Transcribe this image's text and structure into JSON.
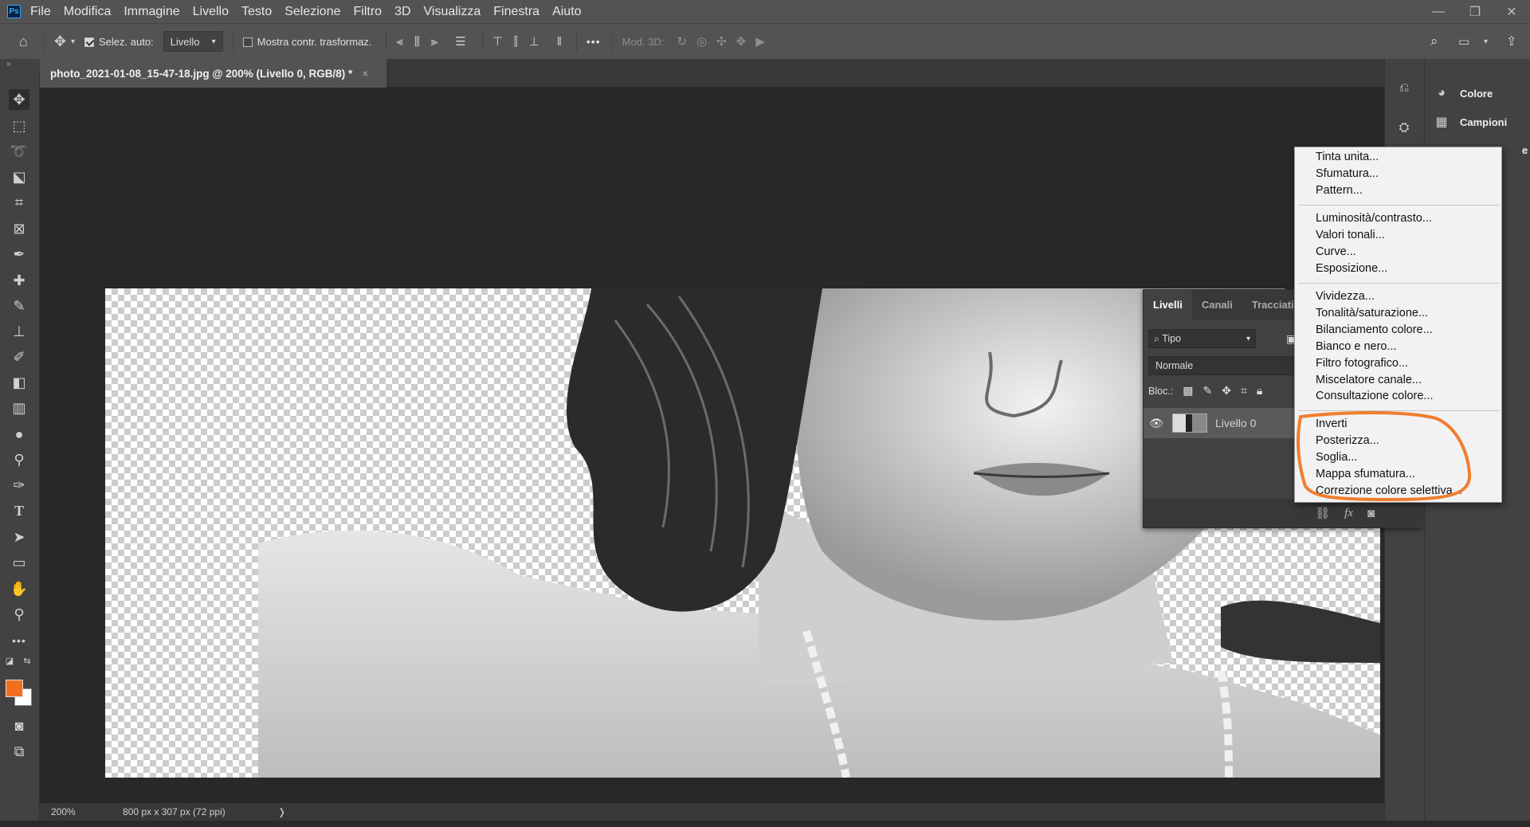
{
  "menubar": {
    "logo": "Ps",
    "items": [
      "File",
      "Modifica",
      "Immagine",
      "Livello",
      "Testo",
      "Selezione",
      "Filtro",
      "3D",
      "Visualizza",
      "Finestra",
      "Aiuto"
    ],
    "window_controls": [
      "—",
      "❐",
      "✕"
    ]
  },
  "options": {
    "auto_select_label": "Selez. auto:",
    "auto_select_checked": true,
    "auto_select_value": "Livello",
    "transform_controls_label": "Mostra contr. trasformaz.",
    "transform_controls_checked": false,
    "mode3d_label": "Mod. 3D:",
    "more": "•••"
  },
  "document": {
    "tab_title": "photo_2021-01-08_15-47-18.jpg @ 200% (Livello 0, RGB/8) *",
    "tab_close": "×"
  },
  "status": {
    "zoom": "200%",
    "info": "800 px x 307 px (72 ppi)",
    "arrow": "❭"
  },
  "toolbar": {
    "foreground_color": "#f26f21",
    "background_color": "#ffffff",
    "more": "•••"
  },
  "dock": {
    "items": [
      {
        "label": "Colore",
        "icon": "palette-icon"
      },
      {
        "label": "Campioni",
        "icon": "swatches-grid-icon"
      }
    ],
    "partially_hidden_text": "e"
  },
  "layers_panel": {
    "tabs": [
      "Livelli",
      "Canali",
      "Tracciati"
    ],
    "filter_label": "Tipo",
    "blend_mode": "Normale",
    "lock_label": "Bloc.:",
    "layers": [
      {
        "name": "Livello 0",
        "visible": true
      }
    ]
  },
  "adjustment_menu": {
    "groups": [
      [
        "Tinta unita...",
        "Sfumatura...",
        "Pattern..."
      ],
      [
        "Luminosità/contrasto...",
        "Valori tonali...",
        "Curve...",
        "Esposizione..."
      ],
      [
        "Vividezza...",
        "Tonalità/saturazione...",
        "Bilanciamento colore...",
        "Bianco e nero...",
        "Filtro fotografico...",
        "Miscelatore canale...",
        "Consultazione colore..."
      ],
      [
        "Inverti",
        "Posterizza...",
        "Soglia...",
        "Mappa sfumatura...",
        "Correzione colore selettiva..."
      ]
    ],
    "highlight_color": "#f07d2e"
  }
}
